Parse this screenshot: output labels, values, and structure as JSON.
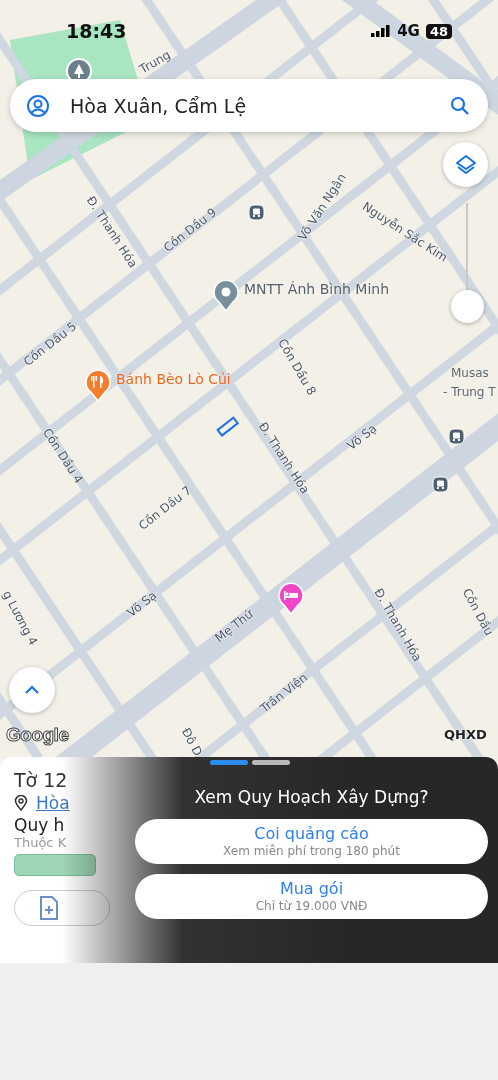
{
  "status_bar": {
    "time": "18:43",
    "network": "4G",
    "battery": "48"
  },
  "search": {
    "value": "Hòa Xuân, Cẩm Lệ"
  },
  "map": {
    "labels": [
      {
        "text": "Trung"
      },
      {
        "text": "Đ. Thanh Hóa"
      },
      {
        "text": "Cồn Dầu 9"
      },
      {
        "text": "Võ Văn Ngân"
      },
      {
        "text": "Nguyễn Sắc Kim"
      },
      {
        "text": "Cồn Dầu 5"
      },
      {
        "text": "Cồn Dầu 8"
      },
      {
        "text": "Đ. Thanh Hóa"
      },
      {
        "text": "Võ Sạ"
      },
      {
        "text": "Cồn Dầu 4"
      },
      {
        "text": "Cồn Dầu 7"
      },
      {
        "text": "Võ Sạ"
      },
      {
        "text": "Mẹ Thứ"
      },
      {
        "text": "Đ. Thanh Hóa"
      },
      {
        "text": "Trần Viện"
      },
      {
        "text": "Cồn Dầu"
      },
      {
        "text": "g Lương 4"
      },
      {
        "text": "Đô D"
      }
    ],
    "places": [
      {
        "name": "MNTT Ánh Bình Minh",
        "kind": "school"
      },
      {
        "name": "Bánh Bèo Lò Củi",
        "kind": "food"
      },
      {
        "kind": "hotel"
      }
    ],
    "area_label": [
      "Musas",
      "- Trung T"
    ],
    "attribution": "Google",
    "source": "QHXD",
    "zoom_slider": {
      "level": 1
    }
  },
  "sheet": {
    "pages": [
      {
        "selected": true
      },
      {
        "selected": false
      }
    ],
    "title": "Tờ 12",
    "address": "Hòa",
    "heading": "Quy h",
    "subheading": "Thuộc K",
    "actions": [
      {
        "kind": "add"
      }
    ]
  },
  "dialog": {
    "title": "Xem Quy Hoạch Xây Dựng?",
    "options": [
      {
        "title": "Coi quảng cáo",
        "subtitle": "Xem miễn phí trong 180 phút"
      },
      {
        "title": "Mua gói",
        "subtitle": "Chỉ từ 19.000 VNĐ"
      }
    ]
  }
}
